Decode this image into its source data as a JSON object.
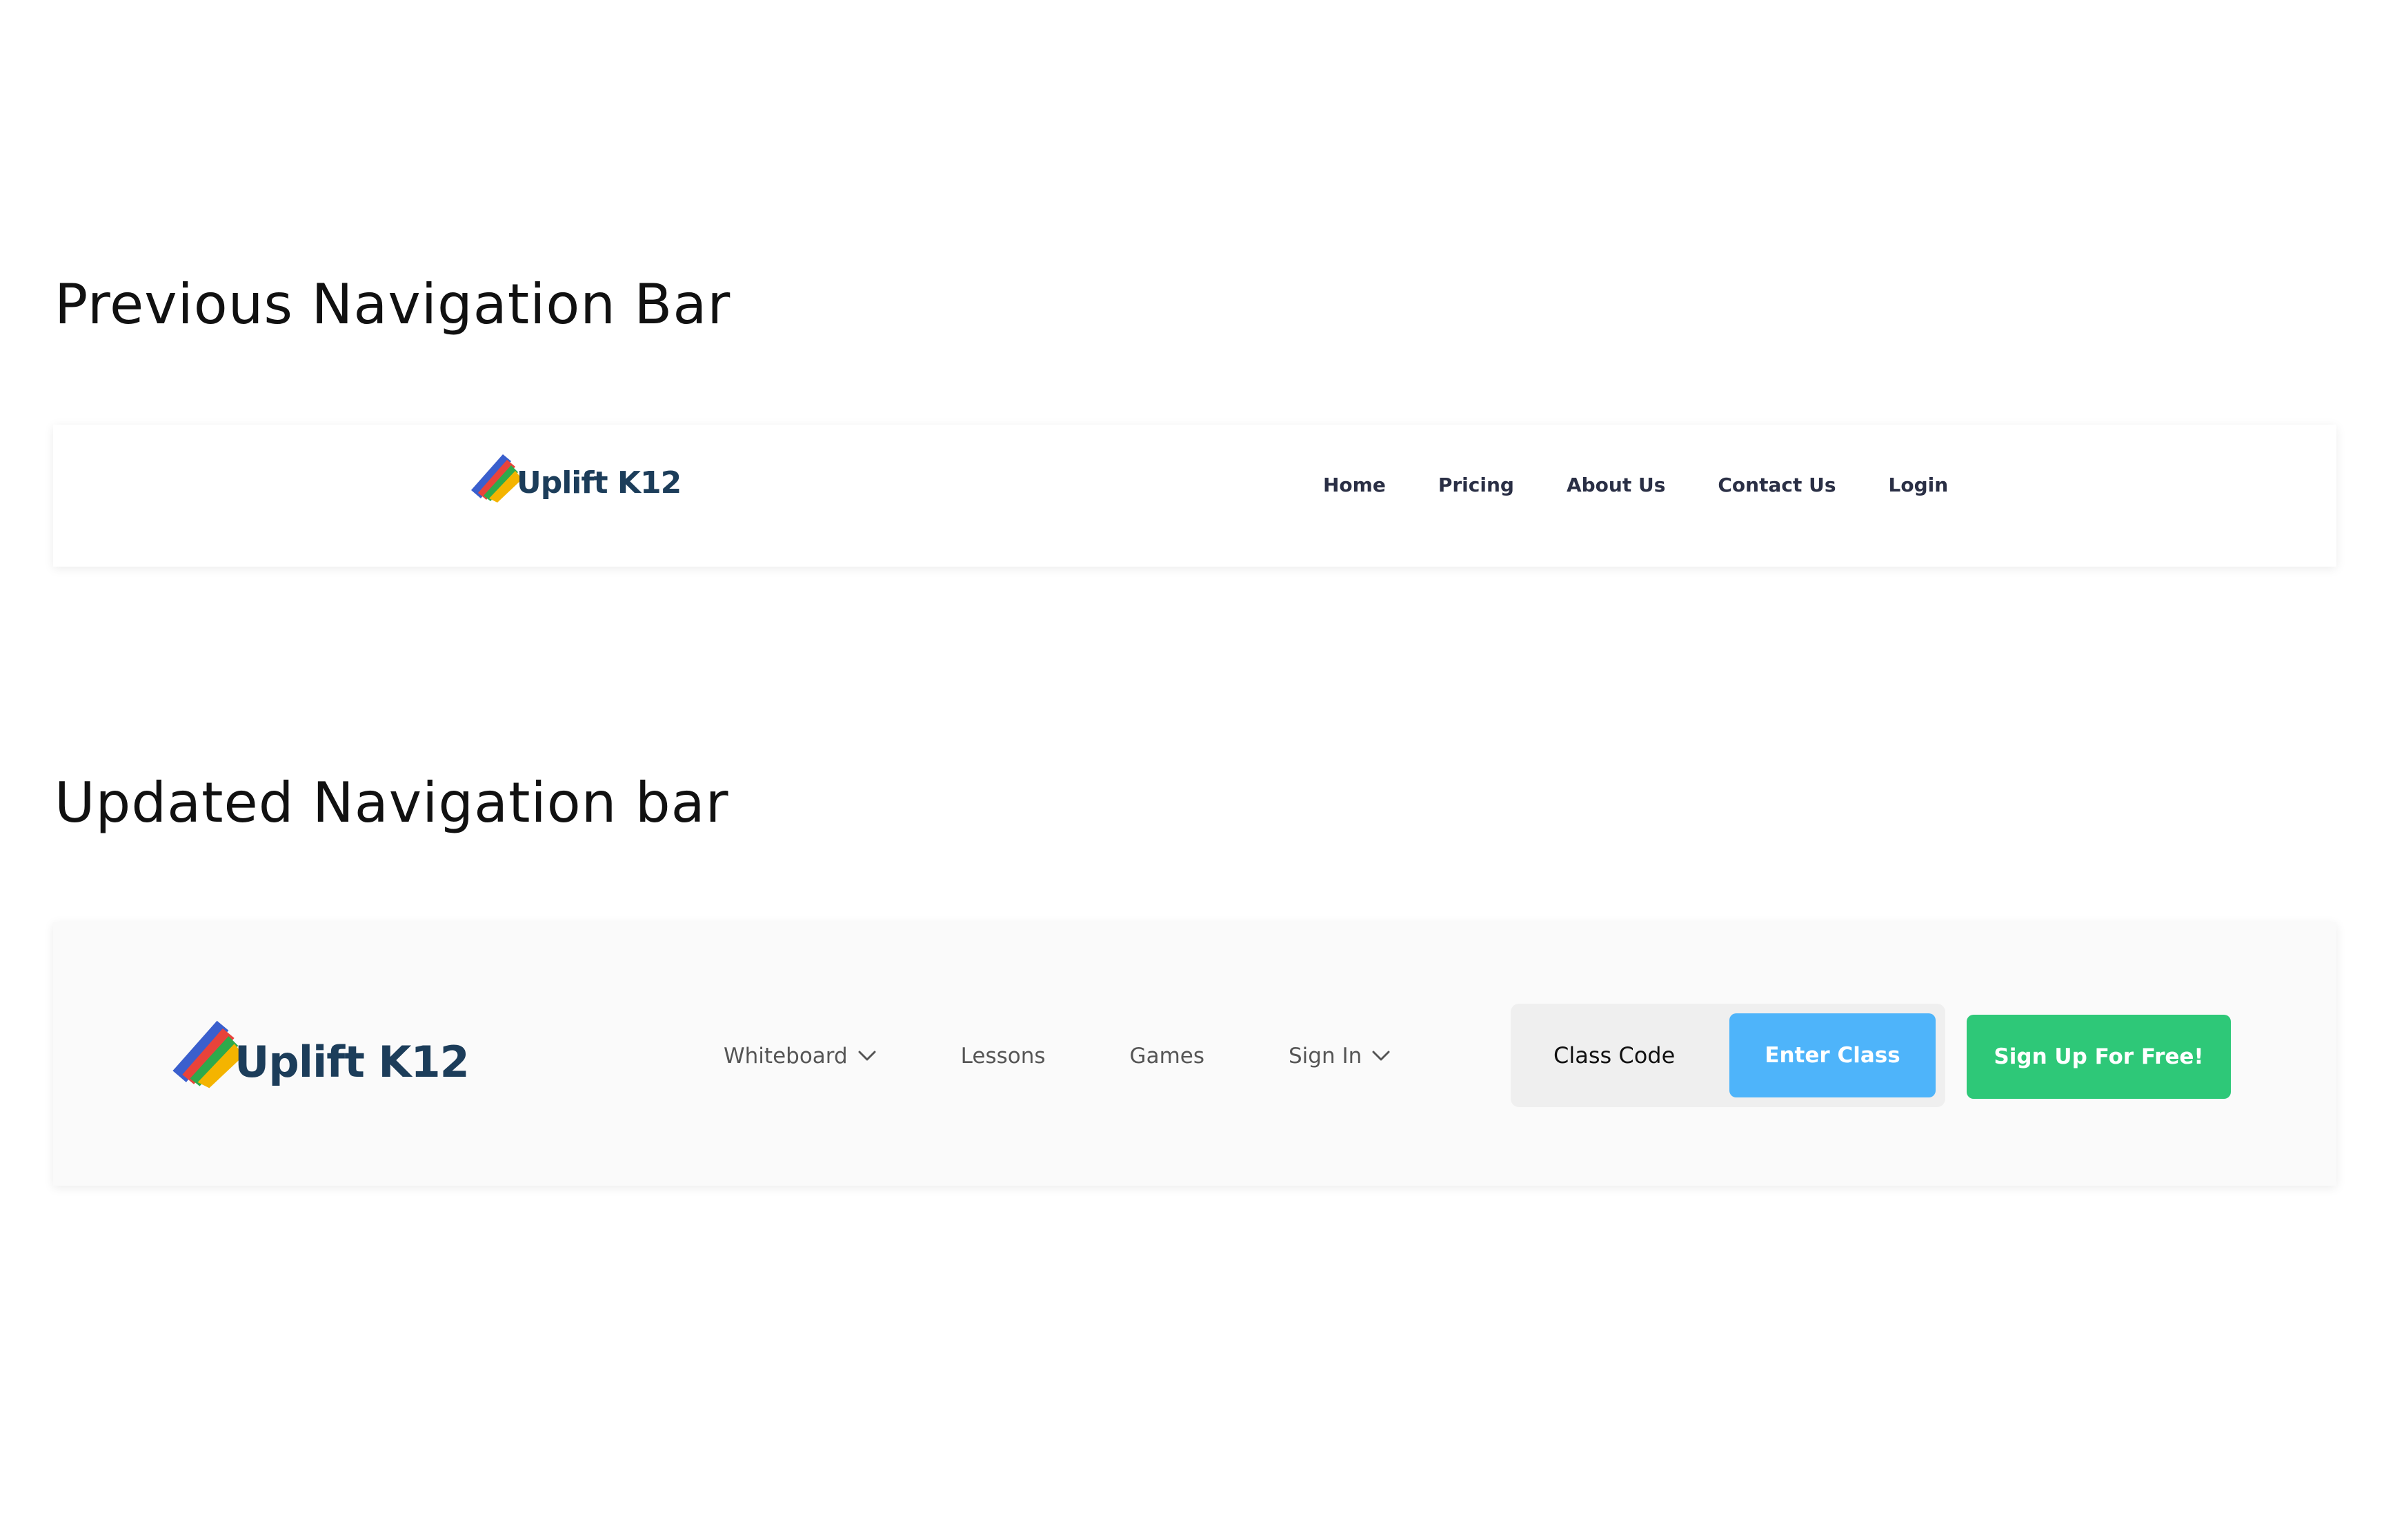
{
  "sections": {
    "previous_title": "Previous Navigation Bar",
    "updated_title": "Updated Navigation bar"
  },
  "brand": {
    "name": "Uplift K12",
    "text_color": "#1c3d5a",
    "logo_icon": "colorful-pages-logo-icon",
    "logo_colors": [
      "#3a5fcd",
      "#e8433a",
      "#2eaa4b",
      "#f4b400"
    ]
  },
  "previous_nav": {
    "links": [
      {
        "label": "Home"
      },
      {
        "label": "Pricing"
      },
      {
        "label": "About Us"
      },
      {
        "label": "Contact Us"
      },
      {
        "label": "Login"
      }
    ]
  },
  "updated_nav": {
    "links": [
      {
        "label": "Whiteboard",
        "icon": "chevron-down-icon"
      },
      {
        "label": "Lessons"
      },
      {
        "label": "Games"
      },
      {
        "label": "Sign In",
        "icon": "chevron-down-icon"
      }
    ],
    "class_code": {
      "placeholder": "Class Code",
      "button_label": "Enter Class",
      "button_color": "#4eb4fa"
    },
    "signup": {
      "label": "Sign Up For Free!",
      "color": "#2ec878"
    }
  }
}
